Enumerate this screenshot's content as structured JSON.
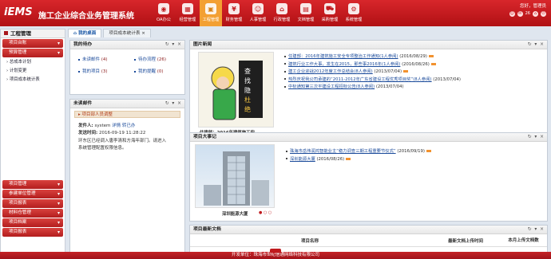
{
  "header": {
    "logo": "iEMS",
    "system_name": "施工企业综合业务管理系统",
    "user_text": "您好，管理员",
    "user_count": "26",
    "modules": [
      {
        "label": "OA办公",
        "icon": "oa-icon"
      },
      {
        "label": "经营管理",
        "icon": "business-icon"
      },
      {
        "label": "工程管理",
        "icon": "project-icon",
        "active": true
      },
      {
        "label": "财务管理",
        "icon": "finance-icon"
      },
      {
        "label": "人事管理",
        "icon": "hr-icon"
      },
      {
        "label": "行政管理",
        "icon": "admin-icon"
      },
      {
        "label": "文档管理",
        "icon": "document-icon"
      },
      {
        "label": "采购管理",
        "icon": "purchase-icon"
      },
      {
        "label": "系统管理",
        "icon": "settings-icon"
      }
    ]
  },
  "sidebar": {
    "title": "工程管理",
    "top_groups": [
      {
        "label": "项目台账"
      },
      {
        "label": "预算管理"
      }
    ],
    "sub_items": [
      "总成本计划",
      "计划变更",
      "项目成本统计表"
    ],
    "bottom_groups": [
      "项目管理",
      "参建单位管理",
      "项目报表",
      "材料仓管理",
      "项目档案",
      "项目报表"
    ]
  },
  "tabs": [
    {
      "label": "我的桌面",
      "active": true
    },
    {
      "label": "项目成本统计表"
    }
  ],
  "todo": {
    "title": "我的待办",
    "items": [
      {
        "label": "未读邮件",
        "count": "(4)"
      },
      {
        "label": "待办流程",
        "count": "(26)"
      },
      {
        "label": "我的项目",
        "count": "(3)"
      },
      {
        "label": "我的提醒",
        "count": "(0)"
      }
    ]
  },
  "mail": {
    "title": "未读邮件",
    "subject": "项目部人员调整",
    "sender_label": "发件人:",
    "sender": "system",
    "detail_link": "详情",
    "read_link": "转已办",
    "time_label": "发送时间:",
    "time": "2016-09-19 11:28:22",
    "body": "环东区已经调入唐李清和方海年部门。请进入系统管理配置权限信息。"
  },
  "news": {
    "title": "图片新闻",
    "image_caption": "住建部：2016年建筑施工安...",
    "items": [
      {
        "title": "住建部：2016年建筑施工安全专项整治工作通知(1人参阅)",
        "date": "(2016/08/29)",
        "tag": true
      },
      {
        "title": "建筑行业工作大事，发生在2015，那些事2016年(1人参阅)",
        "date": "(2016/08/26)",
        "tag": true
      },
      {
        "title": "建工企业迎战2012年度工作总结会(8人参阅)",
        "date": "(2013/07/04)",
        "tag": true
      },
      {
        "title": "热烈庆祝我公司承建的“2011-2012年广东省建设工程优秀项目奖”(8人参阅)",
        "date": "(2013/07/04)",
        "tag": false
      },
      {
        "title": "中标通知第三次平建设工程招标公告(8人参阅)",
        "date": "(2013/07/04)",
        "tag": false
      }
    ]
  },
  "events": {
    "title": "项目大事记",
    "image_caption": "深圳能源大厦",
    "items": [
      {
        "title": "珠海市岳伟润鸿智能业主“稳力调查三期工程重要节仪式”",
        "date": "(2016/09/19)",
        "tag": true
      },
      {
        "title": "深圳能源大厦",
        "date": "(2016/08/26)",
        "tag": true
      }
    ]
  },
  "docs": {
    "title": "项目最新文档",
    "columns": [
      "项目名称",
      "最新文档上传时间",
      "本月上传文档数"
    ]
  },
  "footer": {
    "text": "开发单位：珠海市世纪信通网络科技有限公司"
  },
  "colors": {
    "header_red": "#c01a1e",
    "active_orange": "#f3a033",
    "link_blue": "#1a4a9a"
  }
}
